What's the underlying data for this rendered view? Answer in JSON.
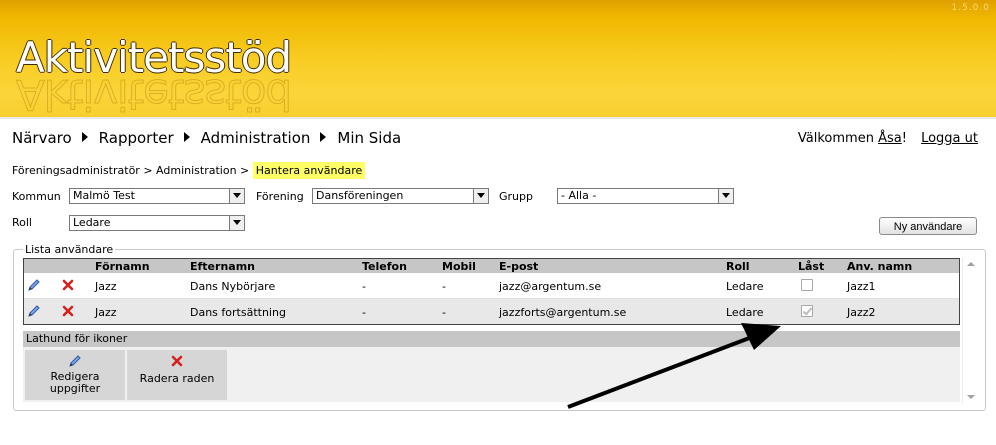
{
  "header": {
    "title": "Aktivitetsstöd",
    "version": "1.5.0.0"
  },
  "nav": {
    "items": [
      "Närvaro",
      "Rapporter",
      "Administration",
      "Min Sida"
    ]
  },
  "user": {
    "welcome_prefix": "Välkommen ",
    "name": "Åsa",
    "welcome_suffix": "!",
    "logout": "Logga ut"
  },
  "breadcrumb": {
    "items": [
      "Föreningsadministratör",
      "Administration",
      "Hantera användare"
    ],
    "separator": ">"
  },
  "filters": {
    "kommun_label": "Kommun",
    "kommun_value": "Malmö Test",
    "forening_label": "Förening",
    "forening_value": "Dansföreningen",
    "grupp_label": "Grupp",
    "grupp_value": "- Alla -",
    "roll_label": "Roll",
    "roll_value": "Ledare",
    "new_user_button": "Ny användare"
  },
  "users_list": {
    "legend": "Lista användare",
    "columns": [
      "Förnamn",
      "Efternamn",
      "Telefon",
      "Mobil",
      "E-post",
      "Roll",
      "Låst",
      "Anv. namn"
    ],
    "rows": [
      {
        "fornamn": "Jazz",
        "efternamn": "Dans Nybörjare",
        "telefon": "-",
        "mobil": "-",
        "epost": "jazz@argentum.se",
        "roll": "Ledare",
        "last": false,
        "anvnamn": "Jazz1"
      },
      {
        "fornamn": "Jazz",
        "efternamn": "Dans fortsättning",
        "telefon": "-",
        "mobil": "-",
        "epost": "jazzforts@argentum.se",
        "roll": "Ledare",
        "last": true,
        "anvnamn": "Jazz2"
      }
    ]
  },
  "icon_legend": {
    "title": "Lathund för ikoner",
    "items": [
      {
        "icon": "pencil-icon",
        "label_line1": "Redigera",
        "label_line2": "uppgifter"
      },
      {
        "icon": "delete-x-icon",
        "label_line1": "Radera raden",
        "label_line2": ""
      }
    ]
  },
  "colors": {
    "header_top": "#e0a000",
    "header_bottom": "#f8cf2e",
    "crumb_highlight": "#ffff66",
    "delete_red": "#d42020",
    "edit_blue": "#3a6fc4"
  }
}
